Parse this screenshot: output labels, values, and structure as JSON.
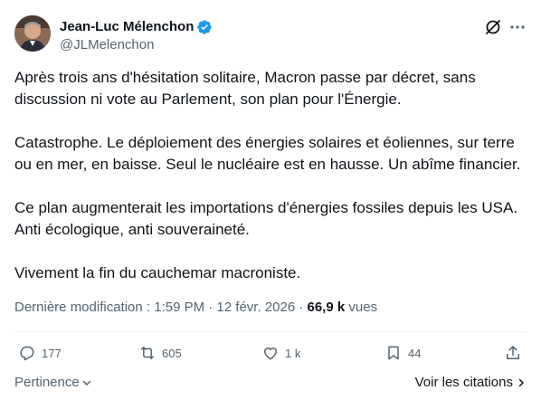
{
  "author": {
    "name": "Jean-Luc Mélenchon",
    "handle": "@JLMelenchon"
  },
  "tweet": {
    "paragraphs": [
      "Après trois ans d'hésitation solitaire, Macron passe par décret, sans discussion ni vote au Parlement, son plan pour l'Énergie.",
      "Catastrophe. Le déploiement des énergies solaires et éoliennes, sur terre ou en mer, en baisse. Seul le nucléaire est en hausse. Un abîme financier.",
      "Ce plan augmenterait les importations d'énergies fossiles depuis les USA. Anti écologique, anti souveraineté.",
      "Vivement la fin du cauchemar macroniste."
    ]
  },
  "meta": {
    "modified": "Dernière modification : 1:59 PM · 12 févr. 2026 · ",
    "views_count": "66,9 k",
    "views_label": " vues"
  },
  "actions": {
    "replies": "177",
    "reposts": "605",
    "likes": "1 k",
    "bookmarks": "44"
  },
  "footer": {
    "sort_label": "Pertinence",
    "quotes_label": "Voir les citations"
  },
  "colors": {
    "text": "#0f1419",
    "secondary": "#536471",
    "verified": "#1d9bf0"
  },
  "icons": [
    "verified-badge-icon",
    "grok-icon",
    "more-icon",
    "reply-icon",
    "repost-icon",
    "like-icon",
    "bookmark-icon",
    "share-icon",
    "chevron-down-icon",
    "chevron-right-icon"
  ]
}
